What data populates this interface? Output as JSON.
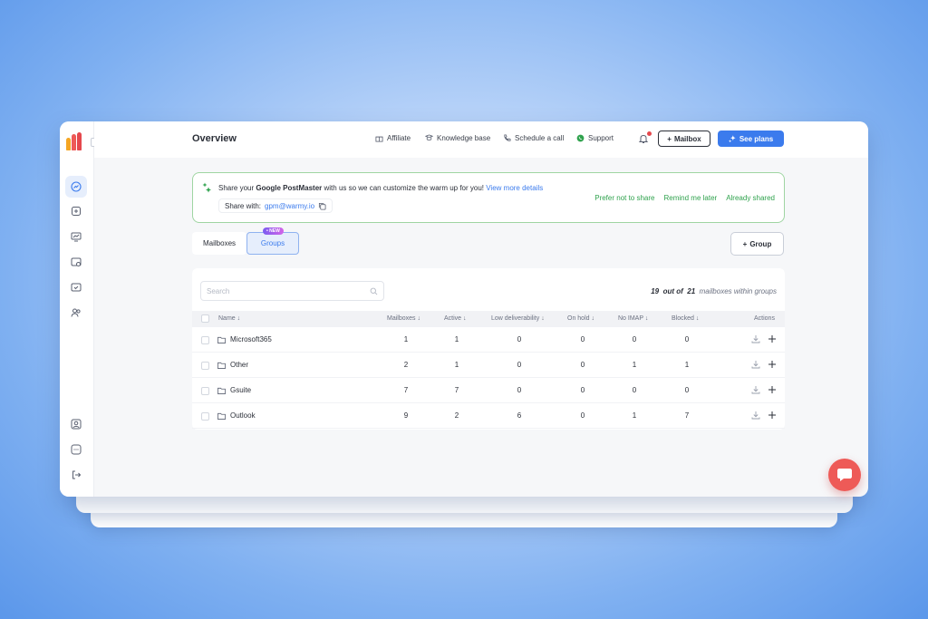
{
  "colors": {
    "accent": "#3b7bed",
    "success": "#2fa24d",
    "chat": "#ee5a57",
    "logo": [
      "#f5a623",
      "#ee5a57",
      "#e5484d"
    ]
  },
  "sidebar": {
    "items": [
      {
        "icon": "dashboard-icon",
        "active": true
      },
      {
        "icon": "add-mailbox-icon"
      },
      {
        "icon": "analytics-icon"
      },
      {
        "icon": "mail-settings-icon"
      },
      {
        "icon": "mail-check-icon"
      },
      {
        "icon": "users-icon"
      }
    ],
    "bottom_items": [
      {
        "icon": "profile-icon"
      },
      {
        "icon": "more-icon"
      },
      {
        "icon": "logout-icon"
      }
    ]
  },
  "header": {
    "title": "Overview",
    "links": [
      {
        "label": "Affiliate",
        "icon": "gift-icon"
      },
      {
        "label": "Knowledge base",
        "icon": "book-icon"
      },
      {
        "label": "Schedule a call",
        "icon": "phone-icon"
      },
      {
        "label": "Support",
        "icon": "whatsapp-icon"
      }
    ],
    "mailbox_button": "Mailbox",
    "plans_button": "See plans"
  },
  "banner": {
    "text_before": "Share your ",
    "text_bold": "Google PostMaster",
    "text_after": " with us so we can customize the warm up for you! ",
    "link": "View more details",
    "share_label": "Share with:",
    "share_email": "gpm@warmy.io",
    "actions": [
      "Prefer not to share",
      "Remind me later",
      "Already shared"
    ]
  },
  "tabs": {
    "mailboxes": "Mailboxes",
    "groups": "Groups",
    "new_badge": "• NEW"
  },
  "group_button": "Group",
  "search": {
    "placeholder": "Search"
  },
  "summary": {
    "count": "19",
    "of_text": "out of",
    "total": "21",
    "suffix": "mailboxes within groups"
  },
  "table": {
    "columns": [
      "Name ↓",
      "Mailboxes ↓",
      "Active ↓",
      "Low deliverability ↓",
      "On hold ↓",
      "No IMAP ↓",
      "Blocked ↓",
      "Actions"
    ],
    "rows": [
      {
        "name": "Microsoft365",
        "mailboxes": "1",
        "active": "1",
        "low": "0",
        "on_hold": "0",
        "no_imap": "0",
        "blocked": "0"
      },
      {
        "name": "Other",
        "mailboxes": "2",
        "active": "1",
        "low": "0",
        "on_hold": "0",
        "no_imap": "1",
        "blocked": "1"
      },
      {
        "name": "Gsuite",
        "mailboxes": "7",
        "active": "7",
        "low": "0",
        "on_hold": "0",
        "no_imap": "0",
        "blocked": "0"
      },
      {
        "name": "Outlook",
        "mailboxes": "9",
        "active": "2",
        "low": "6",
        "on_hold": "0",
        "no_imap": "1",
        "blocked": "7"
      }
    ]
  }
}
